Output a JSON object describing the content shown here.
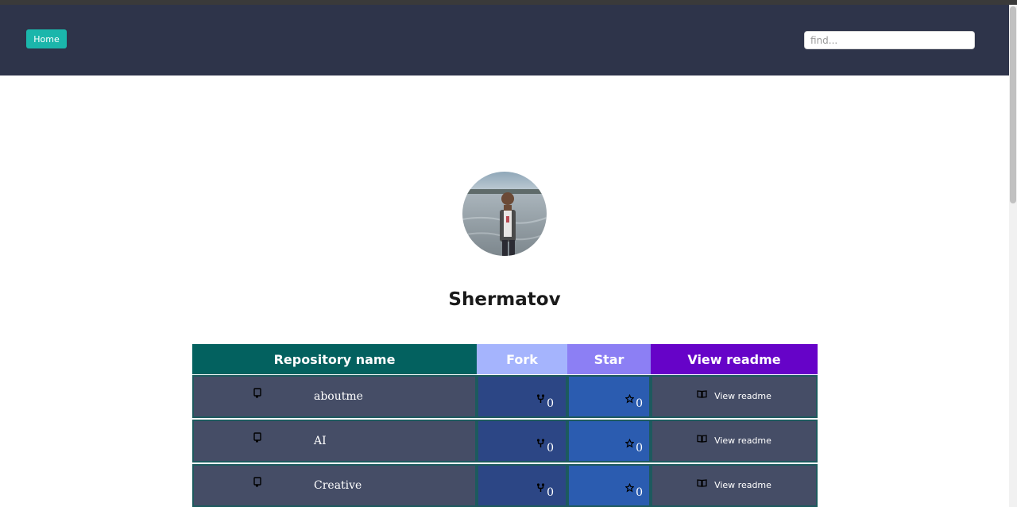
{
  "nav": {
    "home_label": "Home",
    "search_placeholder": "find...",
    "search_value": ""
  },
  "profile": {
    "name": "Shermatov"
  },
  "table": {
    "headers": {
      "name": "Repository name",
      "fork": "Fork",
      "star": "Star",
      "readme": "View readme"
    },
    "header_colors": {
      "name": "#03615f",
      "fork": "#a5b4fd",
      "star": "#8c7ff4",
      "readme": "#6603c8"
    },
    "rows": [
      {
        "name": "aboutme",
        "forks": "0",
        "stars": "0",
        "readme_label": "View readme"
      },
      {
        "name": "AI",
        "forks": "0",
        "stars": "0",
        "readme_label": "View readme"
      },
      {
        "name": "Creative",
        "forks": "0",
        "stars": "0",
        "readme_label": "View readme"
      }
    ]
  },
  "colors": {
    "navbar": "#2e344a",
    "home_button": "#1bb6ab",
    "row_name_cell": "#454d66",
    "row_fork_cell": "#2c4685",
    "row_star_cell": "#2b5cb0"
  },
  "icons": {
    "repo": "repo-icon",
    "fork": "fork-icon",
    "star": "star-icon",
    "readme": "book-icon"
  }
}
